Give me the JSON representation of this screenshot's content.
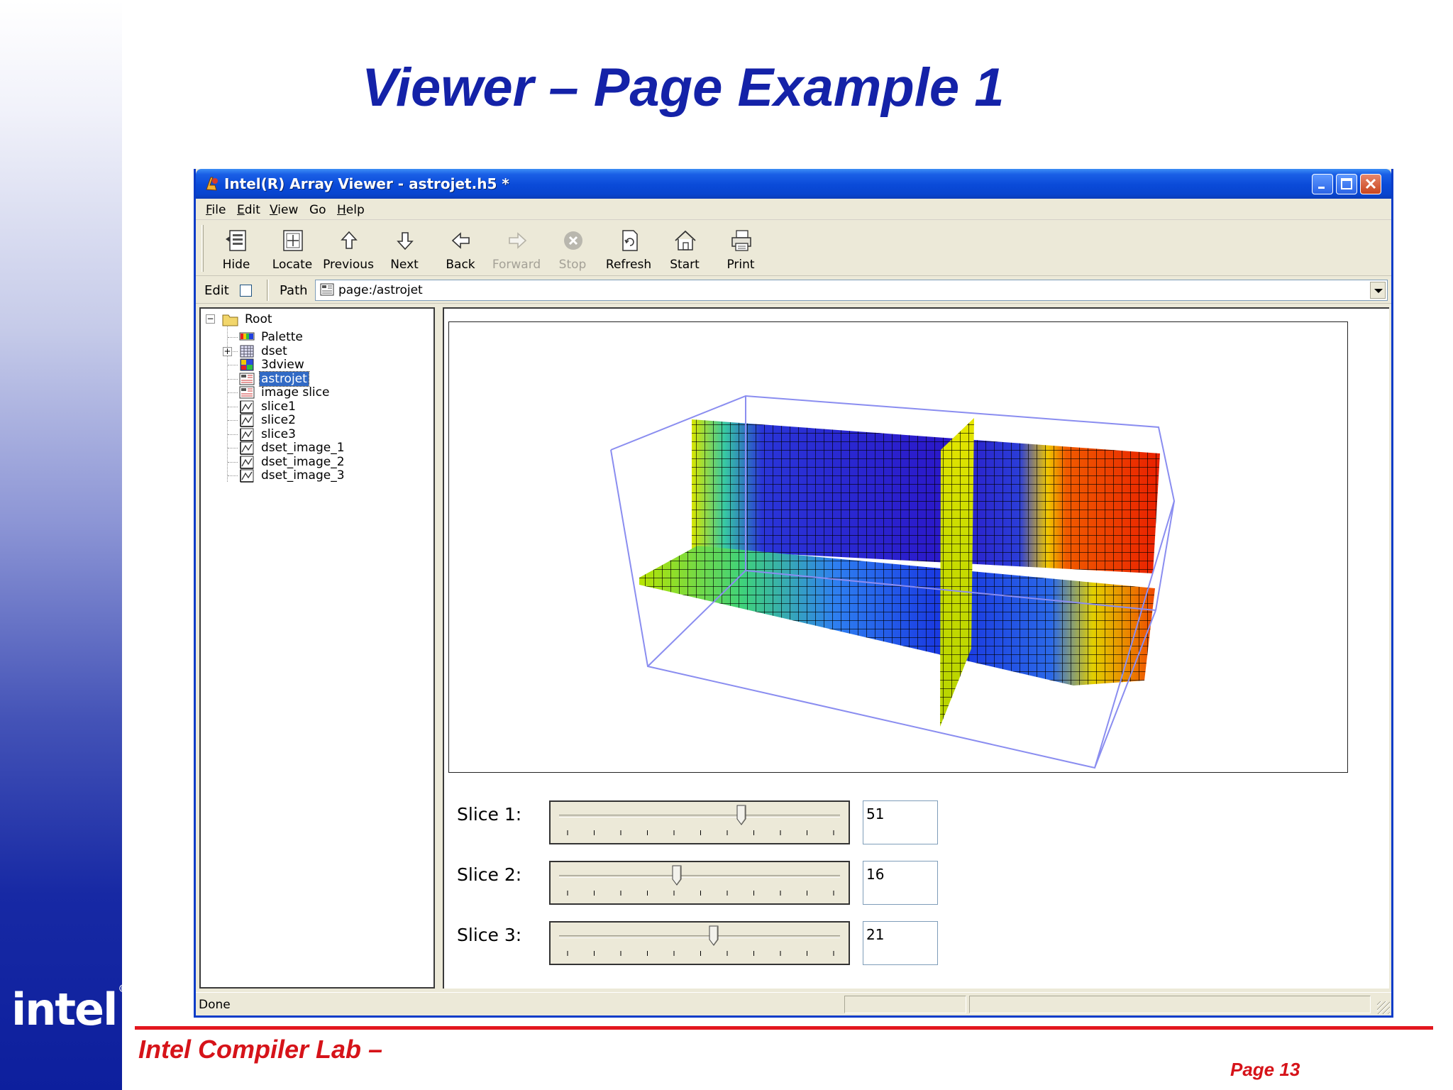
{
  "slide": {
    "title": "Viewer – Page Example 1",
    "footer_left": "Intel Compiler Lab –",
    "footer_right": "Page 13",
    "logo_text": "intel",
    "logo_reg": "®",
    "colors": {
      "title": "#1422a8",
      "footer": "#d61319",
      "rule": "#e3171e",
      "band_bottom": "#0d1f9d"
    }
  },
  "window": {
    "title": "Intel(R) Array Viewer - astrojet.h5 *",
    "menu": [
      {
        "label": "File",
        "key": "F",
        "rest": "ile"
      },
      {
        "label": "Edit",
        "key": "E",
        "rest": "dit"
      },
      {
        "label": "View",
        "key": "V",
        "rest": "iew"
      },
      {
        "label": "Go",
        "key": "",
        "rest": "Go"
      },
      {
        "label": "Help",
        "key": "H",
        "rest": "elp"
      }
    ],
    "toolbar": [
      {
        "label": "Hide",
        "icon": "hide-icon",
        "enabled": true
      },
      {
        "label": "Locate",
        "icon": "locate-icon",
        "enabled": true
      },
      {
        "label": "Previous",
        "icon": "up-arrow-icon",
        "enabled": true
      },
      {
        "label": "Next",
        "icon": "down-arrow-icon",
        "enabled": true
      },
      {
        "label": "Back",
        "icon": "left-arrow-icon",
        "enabled": true
      },
      {
        "label": "Forward",
        "icon": "right-arrow-icon",
        "enabled": false
      },
      {
        "label": "Stop",
        "icon": "stop-icon",
        "enabled": false
      },
      {
        "label": "Refresh",
        "icon": "refresh-icon",
        "enabled": true
      },
      {
        "label": "Start",
        "icon": "home-icon",
        "enabled": true
      },
      {
        "label": "Print",
        "icon": "printer-icon",
        "enabled": true
      }
    ],
    "address": {
      "edit_label": "Edit",
      "edit_checked": false,
      "path_label": "Path",
      "path_value": "page:/astrojet"
    },
    "tree": {
      "root": "Root",
      "items": [
        {
          "label": "Palette",
          "icon": "palette-icon",
          "expandable": false,
          "selected": false
        },
        {
          "label": "dset",
          "icon": "dataset-grid-icon",
          "expandable": true,
          "selected": false
        },
        {
          "label": "3dview",
          "icon": "3d-view-icon",
          "expandable": false,
          "selected": false
        },
        {
          "label": "astrojet",
          "icon": "page-icon",
          "expandable": false,
          "selected": true
        },
        {
          "label": "image slice",
          "icon": "page-icon",
          "expandable": false,
          "selected": false
        },
        {
          "label": "slice1",
          "icon": "plot-icon",
          "expandable": false,
          "selected": false
        },
        {
          "label": "slice2",
          "icon": "plot-icon",
          "expandable": false,
          "selected": false
        },
        {
          "label": "slice3",
          "icon": "plot-icon",
          "expandable": false,
          "selected": false
        },
        {
          "label": "dset_image_1",
          "icon": "plot-icon",
          "expandable": false,
          "selected": false
        },
        {
          "label": "dset_image_2",
          "icon": "plot-icon",
          "expandable": false,
          "selected": false
        },
        {
          "label": "dset_image_3",
          "icon": "plot-icon",
          "expandable": false,
          "selected": false
        }
      ]
    },
    "sliders": [
      {
        "label": "Slice 1:",
        "value": "51",
        "fraction": 0.65
      },
      {
        "label": "Slice 2:",
        "value": "16",
        "fraction": 0.42
      },
      {
        "label": "Slice 3:",
        "value": "21",
        "fraction": 0.55
      }
    ],
    "status": "Done"
  }
}
